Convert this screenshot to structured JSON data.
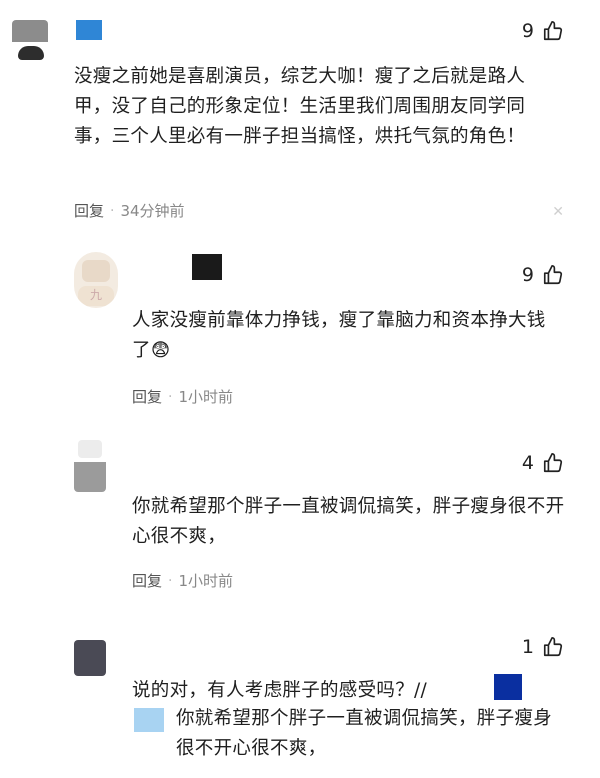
{
  "comments": [
    {
      "likes": "9",
      "text": "没瘦之前她是喜剧演员，综艺大咖！瘦了之后就是路人甲，没了自己的形象定位！生活里我们周围朋友同学同事，三个人里必有一胖子担当搞怪，烘托气氛的角色！",
      "reply_label": "回复",
      "time": "34分钟前"
    },
    {
      "likes": "9",
      "text": "人家没瘦前靠体力挣钱，瘦了靠脑力和资本挣大钱了",
      "emoji": "😨",
      "reply_label": "回复",
      "time": "1小时前"
    },
    {
      "likes": "4",
      "text": "你就希望那个胖子一直被调侃搞笑，胖子瘦身很不开心很不爽，",
      "reply_label": "回复",
      "time": "1小时前"
    },
    {
      "likes": "1",
      "text": "说的对，有人考虑胖子的感受吗？//",
      "quote_text": "你就希望那个胖子一直被调侃搞笑，胖子瘦身很不开心很不爽，"
    }
  ],
  "separator": "·",
  "colors": {
    "blue_tag": "#2f86d6",
    "light_blue_tag": "#a8d3f2",
    "dark_blue_tag": "#0a2fa0"
  }
}
